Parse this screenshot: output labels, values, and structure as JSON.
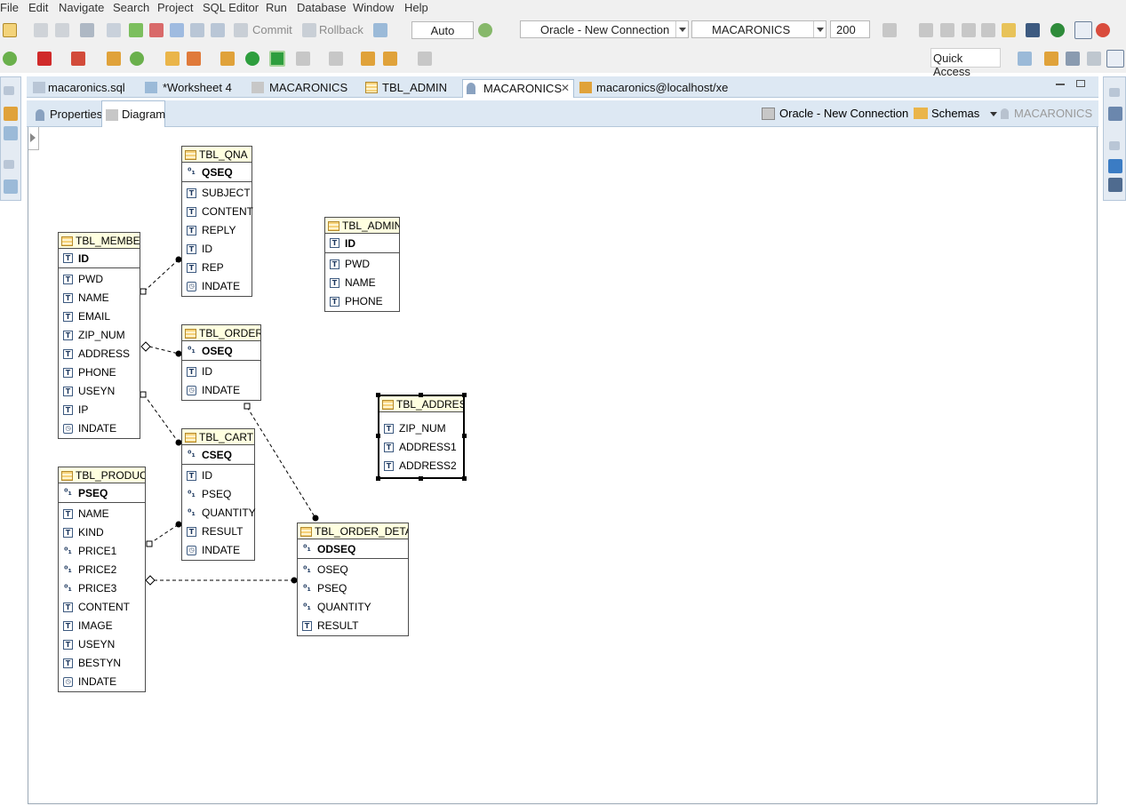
{
  "menu": [
    "File",
    "Edit",
    "Navigate",
    "Search",
    "Project",
    "SQL Editor",
    "Run",
    "Database",
    "Window",
    "Help"
  ],
  "toolbar": {
    "commit_label": "Commit",
    "rollback_label": "Rollback",
    "auto_label": "Auto",
    "connection_combo": "Oracle - New Connection",
    "schema_combo": "MACARONICS",
    "fetch_size": "200",
    "quick_access": "Quick Access"
  },
  "tabs": [
    {
      "label": "macaronics.sql",
      "icon": "sql-file-icon"
    },
    {
      "label": "*Worksheet 4",
      "icon": "sql-worksheet-icon"
    },
    {
      "label": "MACARONICS",
      "icon": "schema-icon"
    },
    {
      "label": "TBL_ADMIN",
      "icon": "table-icon"
    },
    {
      "label": "MACARONICS",
      "icon": "user-schema-icon",
      "active": true
    },
    {
      "label": "macaronics@localhost/xe",
      "icon": "database-icon"
    }
  ],
  "subtabs": {
    "properties": "Properties",
    "diagram": "Diagram",
    "connection": "Oracle - New Connection",
    "schemas": "Schemas",
    "schema_name": "MACARONICS"
  },
  "tables": {
    "qna": {
      "name": "TBL_QNA",
      "pk": "QSEQ",
      "cols": [
        "SUBJECT",
        "CONTENT",
        "REPLY",
        "ID",
        "REP",
        "INDATE"
      ]
    },
    "admin": {
      "name": "TBL_ADMIN",
      "pk": "ID",
      "cols": [
        "PWD",
        "NAME",
        "PHONE"
      ]
    },
    "member": {
      "name": "TBL_MEMBER",
      "pk": "ID",
      "cols": [
        "PWD",
        "NAME",
        "EMAIL",
        "ZIP_NUM",
        "ADDRESS",
        "PHONE",
        "USEYN",
        "IP",
        "INDATE"
      ]
    },
    "orders": {
      "name": "TBL_ORDERS",
      "pk": "OSEQ",
      "cols": [
        "ID",
        "INDATE"
      ]
    },
    "address": {
      "name": "TBL_ADDRESS",
      "cols": [
        "ZIP_NUM",
        "ADDRESS1",
        "ADDRESS2"
      ]
    },
    "cart": {
      "name": "TBL_CART",
      "pk": "CSEQ",
      "cols": [
        "ID",
        "PSEQ",
        "QUANTITY",
        "RESULT",
        "INDATE"
      ]
    },
    "product": {
      "name": "TBL_PRODUCT",
      "pk": "PSEQ",
      "cols": [
        "NAME",
        "KIND",
        "PRICE1",
        "PRICE2",
        "PRICE3",
        "CONTENT",
        "IMAGE",
        "USEYN",
        "BESTYN",
        "INDATE"
      ]
    },
    "order_detail": {
      "name": "TBL_ORDER_DETAIL",
      "pk": "ODSEQ",
      "cols": [
        "OSEQ",
        "PSEQ",
        "QUANTITY",
        "RESULT"
      ]
    }
  },
  "colors": {
    "accent": "#dde8f3",
    "table_header": "#ffffe0"
  }
}
